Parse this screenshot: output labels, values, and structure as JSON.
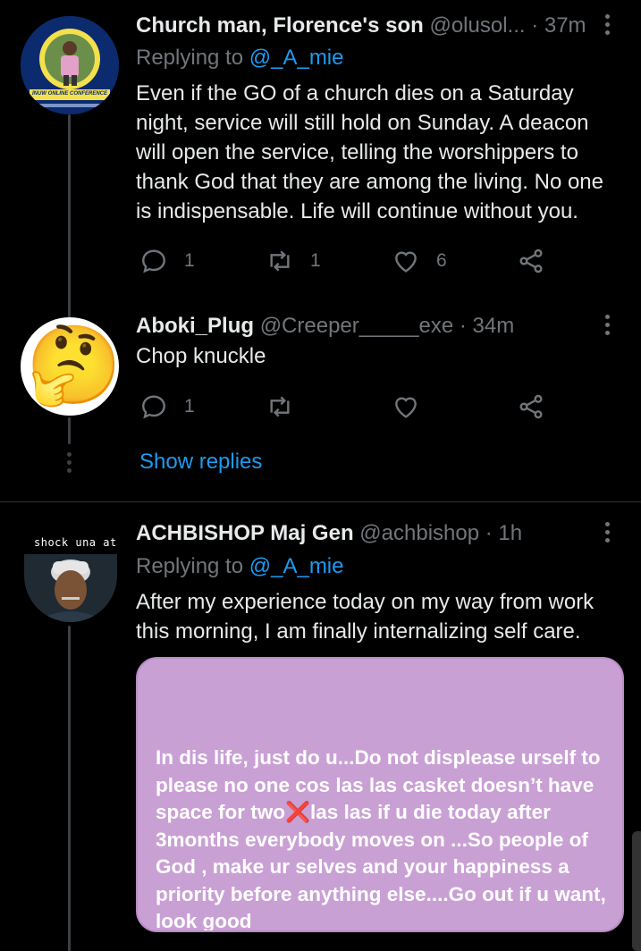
{
  "tweets": [
    {
      "display_name": "Church man, Florence's son",
      "handle": "@olusol...",
      "time": "· 37m",
      "replying_prefix": "Replying to ",
      "replying_to": "@_A_mie",
      "avatar_banner": "INUW ONLINE CONFERENCE",
      "body": "Even if the GO of a church dies on a Saturday night, service will still hold on Sunday. A deacon will open the service, telling the worshippers to thank God that they are among the living. No one is indispensable. Life will continue without you.",
      "replies": "1",
      "retweets": "1",
      "likes": "6"
    },
    {
      "display_name": "Aboki_Plug",
      "handle": "@Creeper_____exe",
      "time": "· 34m",
      "avatar_emoji": "🤔",
      "body": "Chop knuckle",
      "replies": "1",
      "retweets": "",
      "likes": "",
      "show_replies": "Show replies"
    },
    {
      "display_name": "ACHBISHOP Maj Gen",
      "handle": "@achbishop",
      "time": "· 1h",
      "replying_prefix": "Replying to ",
      "replying_to": "@_A_mie",
      "avatar_caption": "shock una at",
      "body": "After my experience today on my way from work this morning, I am finally internalizing self care.",
      "image_text_before_x": "In dis life, just do u...Do not displease urself to please no one cos las las casket doesn’t have space for two",
      "image_x": "❌",
      "image_text_after_x": "las las if u die today after 3months everybody moves on ...So people of God , make ur selves and your happiness a priority before anything else....Go out if u want, look good"
    }
  ],
  "icons": {
    "reply": "reply-icon",
    "retweet": "retweet-icon",
    "like": "heart-icon",
    "share": "share-icon",
    "more": "more-vertical-icon"
  },
  "colors": {
    "background": "#000000",
    "link": "#1d9bf0",
    "muted": "#71767b",
    "text": "#e7e9ea",
    "card": "#c9a0d4"
  }
}
